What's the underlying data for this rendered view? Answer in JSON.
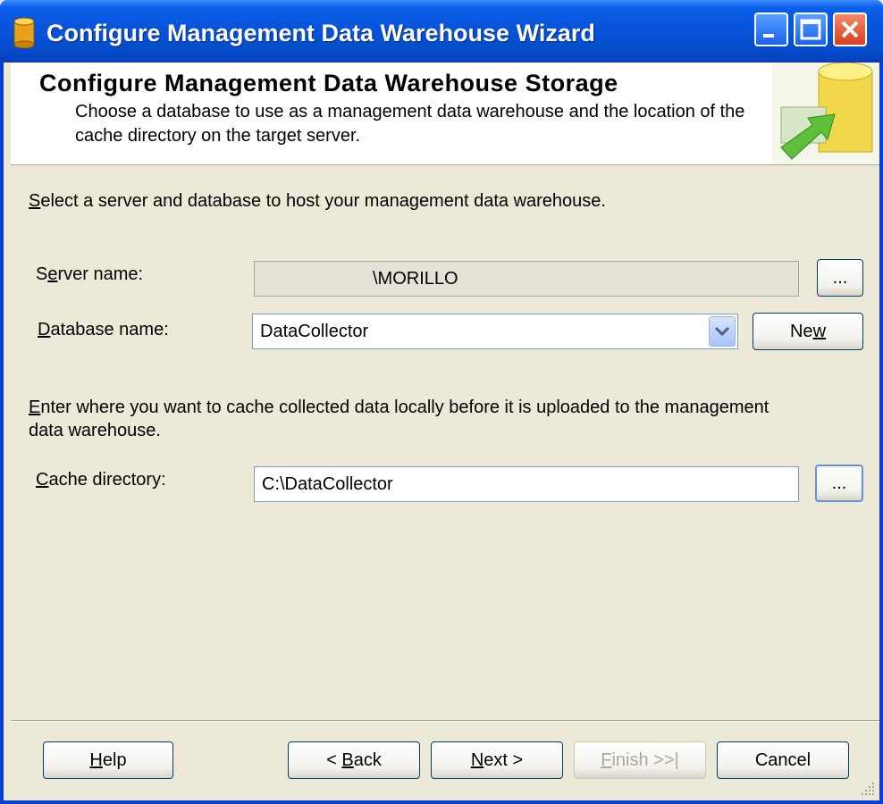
{
  "window": {
    "title": "Configure Management Data Warehouse Wizard",
    "controls": {
      "minimize": "minimize",
      "maximize": "maximize",
      "close": "close"
    }
  },
  "header": {
    "title": "Configure Management Data Warehouse Storage",
    "description": "Choose a database to use as a management data warehouse and the location of the cache directory on the target server."
  },
  "section1": {
    "instruction": {
      "mnemonic": "S",
      "rest": "elect a server and database to host your management data warehouse."
    }
  },
  "server": {
    "label": {
      "before": "S",
      "mnemonic": "e",
      "after": "rver name:"
    },
    "value": "\\MORILLO",
    "browse_label": "..."
  },
  "database": {
    "label": {
      "mnemonic": "D",
      "after": "atabase name:"
    },
    "value": "DataCollector",
    "new_label": {
      "before": "Ne",
      "mnemonic": "w"
    }
  },
  "section2": {
    "instruction": {
      "mnemonic": "E",
      "rest": "nter where you want to cache collected data locally before it is uploaded to the management"
    },
    "instruction_line2": "data warehouse."
  },
  "cache": {
    "label": {
      "mnemonic": "C",
      "after": "ache directory:"
    },
    "value": "C:\\DataCollector",
    "browse_label": "..."
  },
  "footer": {
    "help": {
      "mnemonic": "H",
      "after": "elp"
    },
    "back": {
      "before": "< ",
      "mnemonic": "B",
      "after": "ack"
    },
    "next": {
      "mnemonic": "N",
      "after": "ext >"
    },
    "finish": {
      "mnemonic": "F",
      "after": "inish >>|"
    },
    "cancel": "Cancel"
  },
  "colors": {
    "titlebar": "#0753d8",
    "dialog_bg": "#ece9d8",
    "header_bg": "#ffffff",
    "disabled_text": "#aca899"
  }
}
